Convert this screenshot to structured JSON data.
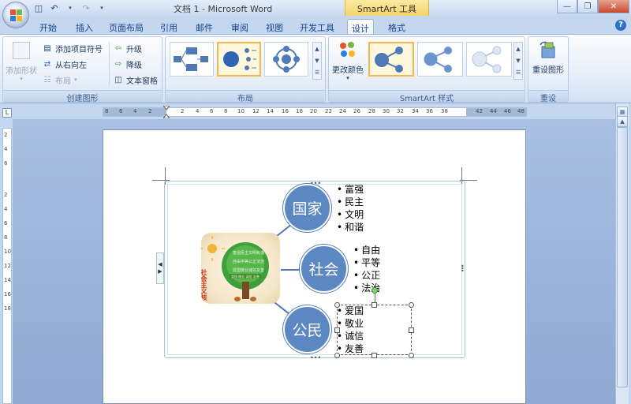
{
  "window": {
    "title": "文档 1 - Microsoft Word",
    "context_tab_title": "SmartArt 工具"
  },
  "tabs": [
    "开始",
    "插入",
    "页面布局",
    "引用",
    "邮件",
    "审阅",
    "视图",
    "开发工具",
    "设计",
    "格式"
  ],
  "active_tab": "设计",
  "ribbon": {
    "create_graphic": {
      "label": "创建图形",
      "add_shape": "添加形状",
      "add_bullet": "添加项目符号",
      "right_to_left": "从右向左",
      "layout": "布局",
      "promote": "升级",
      "demote": "降级",
      "text_pane": "文本窗格"
    },
    "layouts": {
      "label": "布局"
    },
    "styles": {
      "label": "SmartArt 样式",
      "change_colors": "更改颜色"
    },
    "reset": {
      "label": "重设",
      "reset_graphic": "重设图形"
    }
  },
  "ruler": {
    "ticks": [
      "8",
      "6",
      "4",
      "2",
      "2",
      "4",
      "6",
      "8",
      "10",
      "12",
      "14",
      "16",
      "18",
      "20",
      "22",
      "24",
      "26",
      "28",
      "30",
      "32",
      "34",
      "36",
      "38",
      "42",
      "44",
      "46",
      "48"
    ]
  },
  "vruler": {
    "ticks": [
      "2",
      "4",
      "6",
      "2",
      "4",
      "6",
      "8",
      "10",
      "12",
      "14",
      "16",
      "18"
    ]
  },
  "smartart": {
    "nodes": [
      {
        "label": "国家",
        "bullets": [
          "富强",
          "民主",
          "文明",
          "和谐"
        ]
      },
      {
        "label": "社会",
        "bullets": [
          "自由",
          "平等",
          "公正",
          "法治"
        ]
      },
      {
        "label": "公民",
        "bullets": [
          "爱国",
          "敬业",
          "诚信",
          "友善"
        ]
      }
    ],
    "picture_caption": "社会主义核心价值观",
    "picture_leaves": [
      "富强",
      "民主",
      "文明",
      "和谐",
      "自由",
      "平等",
      "公正",
      "法治",
      "爱国",
      "敬业",
      "诚信",
      "友善"
    ],
    "picture_banner": "爱国 敬业 诚信 友善"
  },
  "colors": {
    "node_fill": "#5b87c3",
    "ribbon_bg": "#dbe7f6",
    "context_tab": "#f6d36a"
  }
}
